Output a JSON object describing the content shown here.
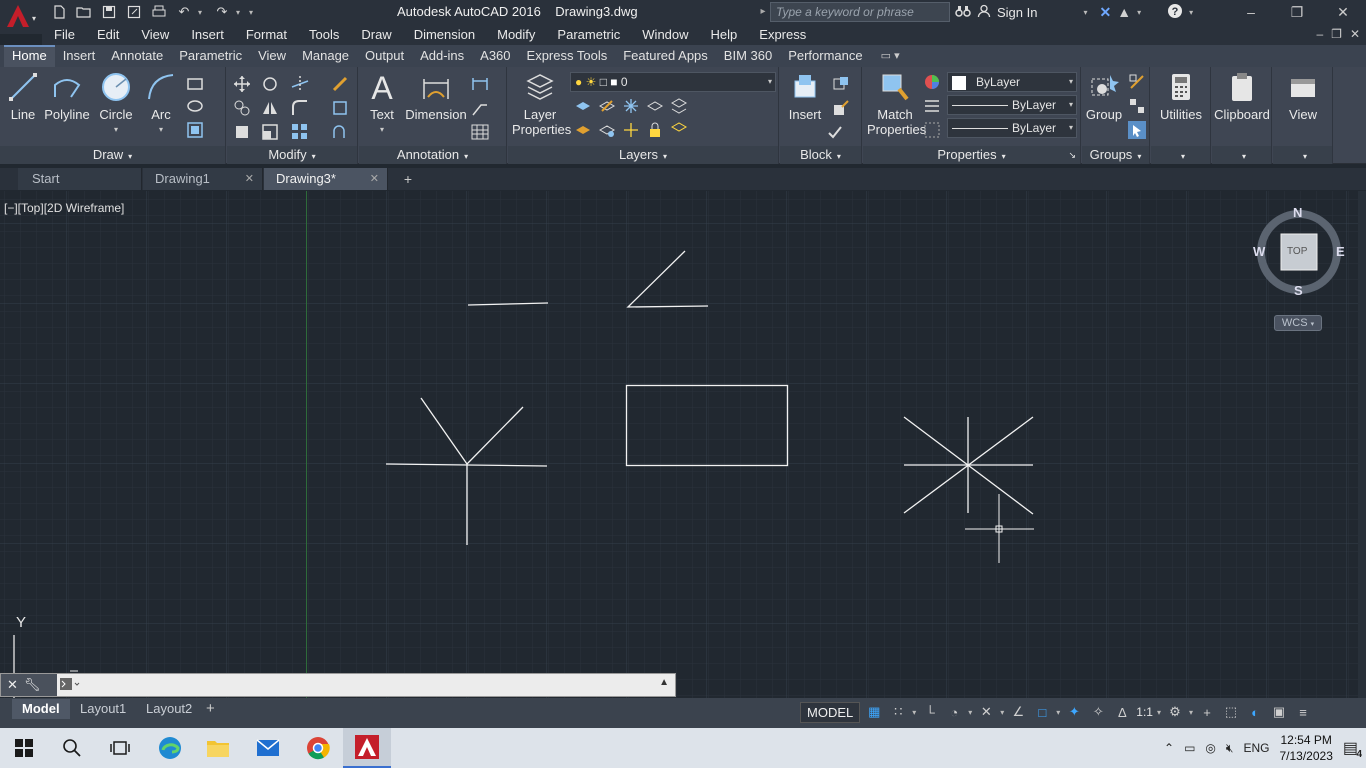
{
  "window": {
    "title": "Autodesk AutoCAD 2016    Drawing3.dwg",
    "search_placeholder": "Type a keyword or phrase",
    "signin": "Sign In"
  },
  "menu": [
    "File",
    "Edit",
    "View",
    "Insert",
    "Format",
    "Tools",
    "Draw",
    "Dimension",
    "Modify",
    "Parametric",
    "Window",
    "Help",
    "Express"
  ],
  "ribbon_tabs": [
    "Home",
    "Insert",
    "Annotate",
    "Parametric",
    "View",
    "Manage",
    "Output",
    "Add-ins",
    "A360",
    "Express Tools",
    "Featured Apps",
    "BIM 360",
    "Performance"
  ],
  "ribbon": {
    "draw": {
      "title": "Draw",
      "line": "Line",
      "polyline": "Polyline",
      "circle": "Circle",
      "arc": "Arc"
    },
    "modify": {
      "title": "Modify"
    },
    "annotation": {
      "title": "Annotation",
      "text": "Text",
      "dimension": "Dimension"
    },
    "layers": {
      "title": "Layers",
      "layer_properties_1": "Layer",
      "layer_properties_2": "Properties",
      "current_layer": "0"
    },
    "block": {
      "title": "Block",
      "insert": "Insert"
    },
    "properties": {
      "title": "Properties",
      "match_1": "Match",
      "match_2": "Properties",
      "color": "ByLayer",
      "linetype": "ByLayer",
      "lineweight": "ByLayer"
    },
    "groups": {
      "title": "Groups",
      "group": "Group"
    },
    "utilities": "Utilities",
    "clipboard": "Clipboard",
    "view": "View"
  },
  "file_tabs": [
    "Start",
    "Drawing1",
    "Drawing3*"
  ],
  "viewport_label": "[−][Top][2D Wireframe]",
  "viewcube": {
    "n": "N",
    "s": "S",
    "e": "E",
    "w": "W",
    "face": "TOP",
    "wcs": "WCS"
  },
  "ucs": {
    "y": "Y"
  },
  "layout_tabs": [
    "Model",
    "Layout1",
    "Layout2"
  ],
  "status": {
    "model": "MODEL",
    "scale": "1:1"
  },
  "tray": {
    "lang": "ENG",
    "time": "12:54 PM",
    "date": "7/13/2023",
    "notifications": "4"
  },
  "colors": {
    "accent": "#3a7bd5",
    "canvas": "#212830",
    "autocad_red": "#c41e2a"
  }
}
